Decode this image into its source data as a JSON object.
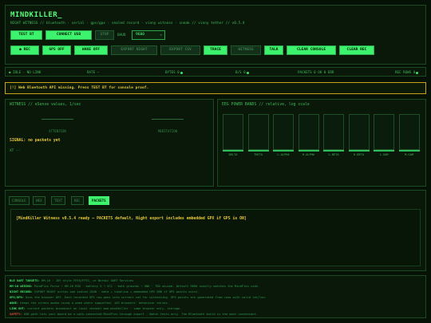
{
  "header": {
    "title": "MINDKILLER_",
    "subtitle": "NIGHT WITNESS // bluetooth · serial · gps/gpx · sealed record · vinny witness · sneak // vinny tether // v0.5.4"
  },
  "controls": {
    "row1": {
      "test_bt": "TEST BT",
      "connect_usb": "CONNECT USB",
      "stop": "STOP",
      "baud_label": "BAUD",
      "baud_value": "9600"
    },
    "row2": {
      "rec": "● REC",
      "gps_off": "GPS OFF",
      "wake_off": "WAKE OFF",
      "export_night": "EXPORT NIGHT",
      "export_csv": "EXPORT CSV",
      "trace": "TRACE",
      "witness": "WITNESS",
      "talk": "TALK",
      "clear_console": "CLEAR CONSOLE",
      "clear_rec": "CLEAR REC"
    }
  },
  "status_bar": {
    "idle": "● IDLE · NO LINK",
    "rate": "RATE —",
    "bytes": "BYTES 0",
    "bs": "B/S 0",
    "packets": "PACKETS 0  OK 0  ERR",
    "rec_rows": "REC ROWS 0"
  },
  "warning": "[!] Web Bluetooth API missing. Press TEST BT for console proof.",
  "witness": {
    "title": "WITNESS // eSense values, 1/sec",
    "attention_label": "ATTENTION",
    "meditation_label": "MEDITATION",
    "signal": "SIGNAL: no packets yet",
    "xt": "XT  --"
  },
  "eeg": {
    "title": "EEG POWER BANDS // relative, log scale",
    "bands": [
      "DELTA",
      "THETA",
      "L-ALPHA",
      "H-ALPHA",
      "L-BETA",
      "H-BETA",
      "L-GAM",
      "M-GAM"
    ]
  },
  "tabs": [
    "CONSOLE",
    "HEX",
    "TEXT",
    "REC",
    "PACKETS"
  ],
  "console_text": "[MindKiller Witness v0.5.4 ready — PACKETS default, Night export includes embedded GPX if GPS is ON]",
  "info": [
    {
      "k": "BLE UART TARGETS:",
      "v": "HM-10 · JDY style FFE0/FFE1, or Nordic UART Services"
    },
    {
      "k": "HM-10 WIRING:",
      "v": "MindFlex Force → HM-10 RXD · battery 5 → VCC · both grounds → GND · TGD unused. Default 9600 usually matches the MindFlex side."
    },
    {
      "k": "NIGHT RECORD:",
      "v": "EXPORT NIGHT writes one sealed JSON · meta + timeline + embedded GPX GND if GPS points exist."
    },
    {
      "k": "GPS/GPX:",
      "v": "Uses the browser API. Each recorded GPS row goes into current cat for witnessing. GPX points are generated from rows with valid lat/lon."
    },
    {
      "k": "WAKE:",
      "v": "Keeps the screen awake using a wake where supported. iOS browsers' behaviour varies."
    },
    {
      "k": "LINK OUT:",
      "v": "current packets broadcast on local channel mwe-mindkiller · same browser only, storage."
    },
    {
      "k": "SAFETY:",
      "v": "USB path lets your board be a walk-connected MindFlex through export · Watch tests only. The Bluetooth build is the most convenient.",
      "warn": true
    }
  ]
}
